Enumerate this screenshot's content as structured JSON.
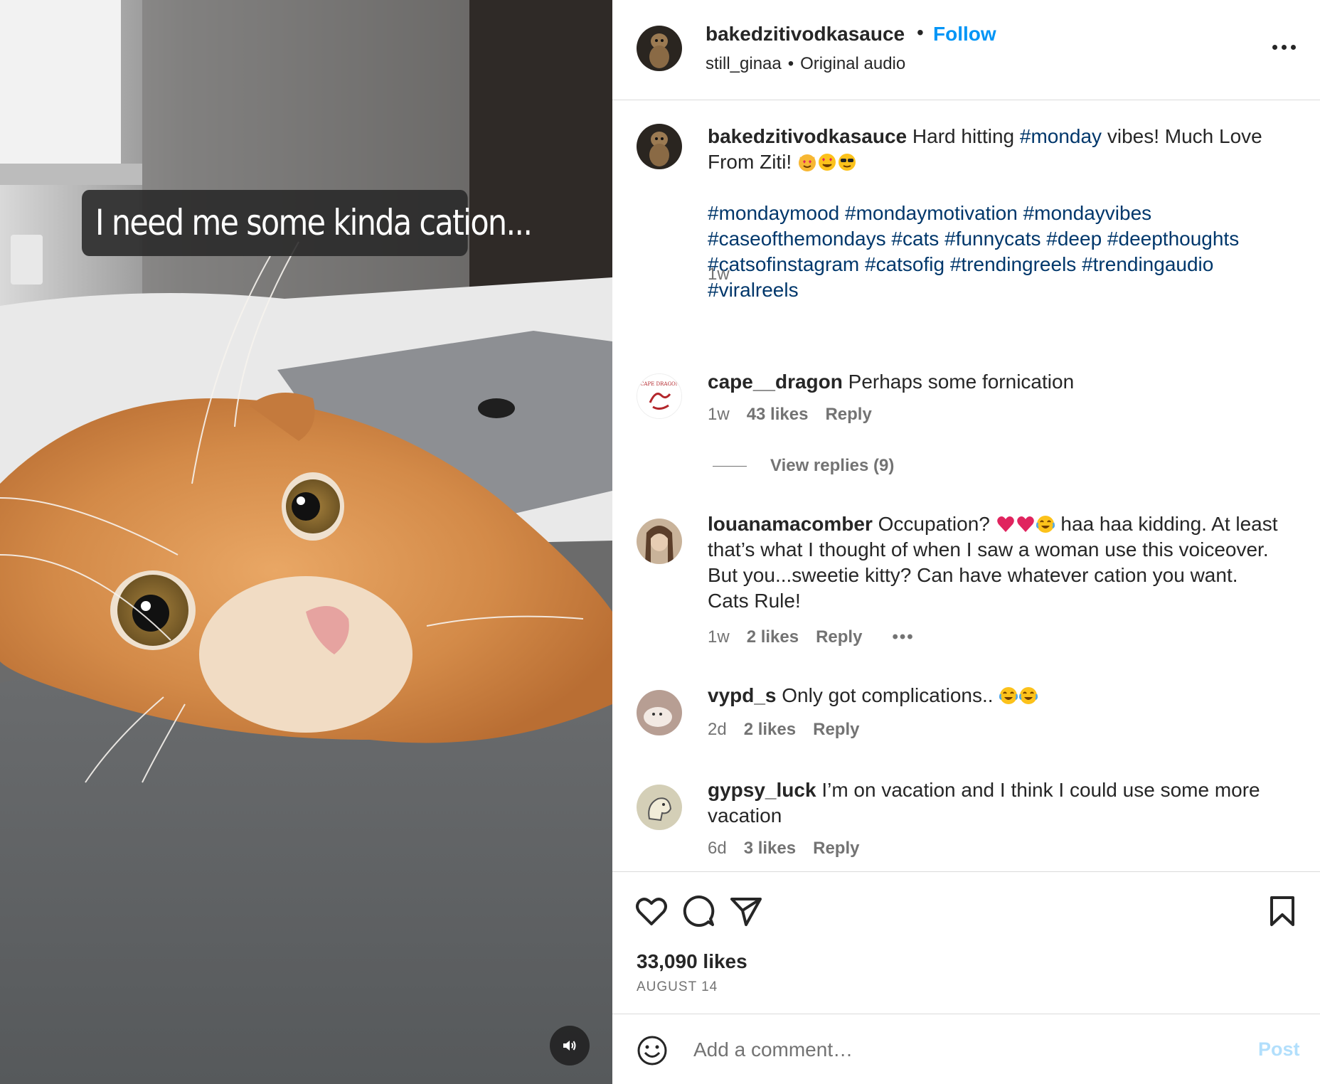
{
  "media": {
    "overlay_caption": "I need me some kinda cation...",
    "mute_icon": "speaker-icon"
  },
  "header": {
    "username": "bakedzitivodkasauce",
    "dot": "•",
    "follow_label": "Follow",
    "audio_user": "still_ginaa",
    "audio_sep": "•",
    "audio_label": "Original audio",
    "more_icon": "more-horizontal-icon"
  },
  "caption": {
    "username": "bakedzitivodkasauce",
    "text_before_tag": "Hard hitting",
    "tag": "#monday",
    "text_after_tag": "vibes! Much Love From Ziti!",
    "hashtags_line1": "#mondaymood #mondaymotivation #mondayvibes",
    "hashtags_line2": "#caseofthemondays #cats #funnycats #deep #deepthoughts",
    "hashtags_line3": "#catsofinstagram #catsofig #trendingreels #trendingaudio",
    "hashtags_line4": "#viralreels",
    "time": "1w"
  },
  "comments": [
    {
      "username": "cape__dragon",
      "text": "Perhaps some fornication",
      "time": "1w",
      "likes": "43 likes",
      "reply": "Reply",
      "view_replies": "View replies (9)"
    },
    {
      "username": "louanamacomber",
      "text_a": "Occupation?",
      "text_b": "haa haa kidding. At least that’s what I thought of when I saw a woman use this voiceover. But you...sweetie kitty? Can have whatever cation you want. Cats Rule!",
      "time": "1w",
      "likes": "2 likes",
      "reply": "Reply",
      "more": "•••"
    },
    {
      "username": "vypd_s",
      "text": "Only got complications..",
      "time": "2d",
      "likes": "2 likes",
      "reply": "Reply"
    },
    {
      "username": "gypsy_luck",
      "text": "I’m on vacation and I think I could use some more vacation",
      "time": "6d",
      "likes": "3 likes",
      "reply": "Reply"
    }
  ],
  "actions": {
    "like_icon": "heart-icon",
    "comment_icon": "comment-bubble-icon",
    "share_icon": "paper-plane-icon",
    "save_icon": "bookmark-icon",
    "likes_count": "33,090 likes",
    "date": "AUGUST 14"
  },
  "add_comment": {
    "placeholder": "Add a comment…",
    "post_label": "Post",
    "emoji_icon": "smiley-icon"
  },
  "colors": {
    "link_blue": "#0095f6",
    "hashtag": "#00376b",
    "secondary_text": "#737373",
    "post_disabled": "#b2dffc",
    "divider": "#dbdbdb"
  }
}
